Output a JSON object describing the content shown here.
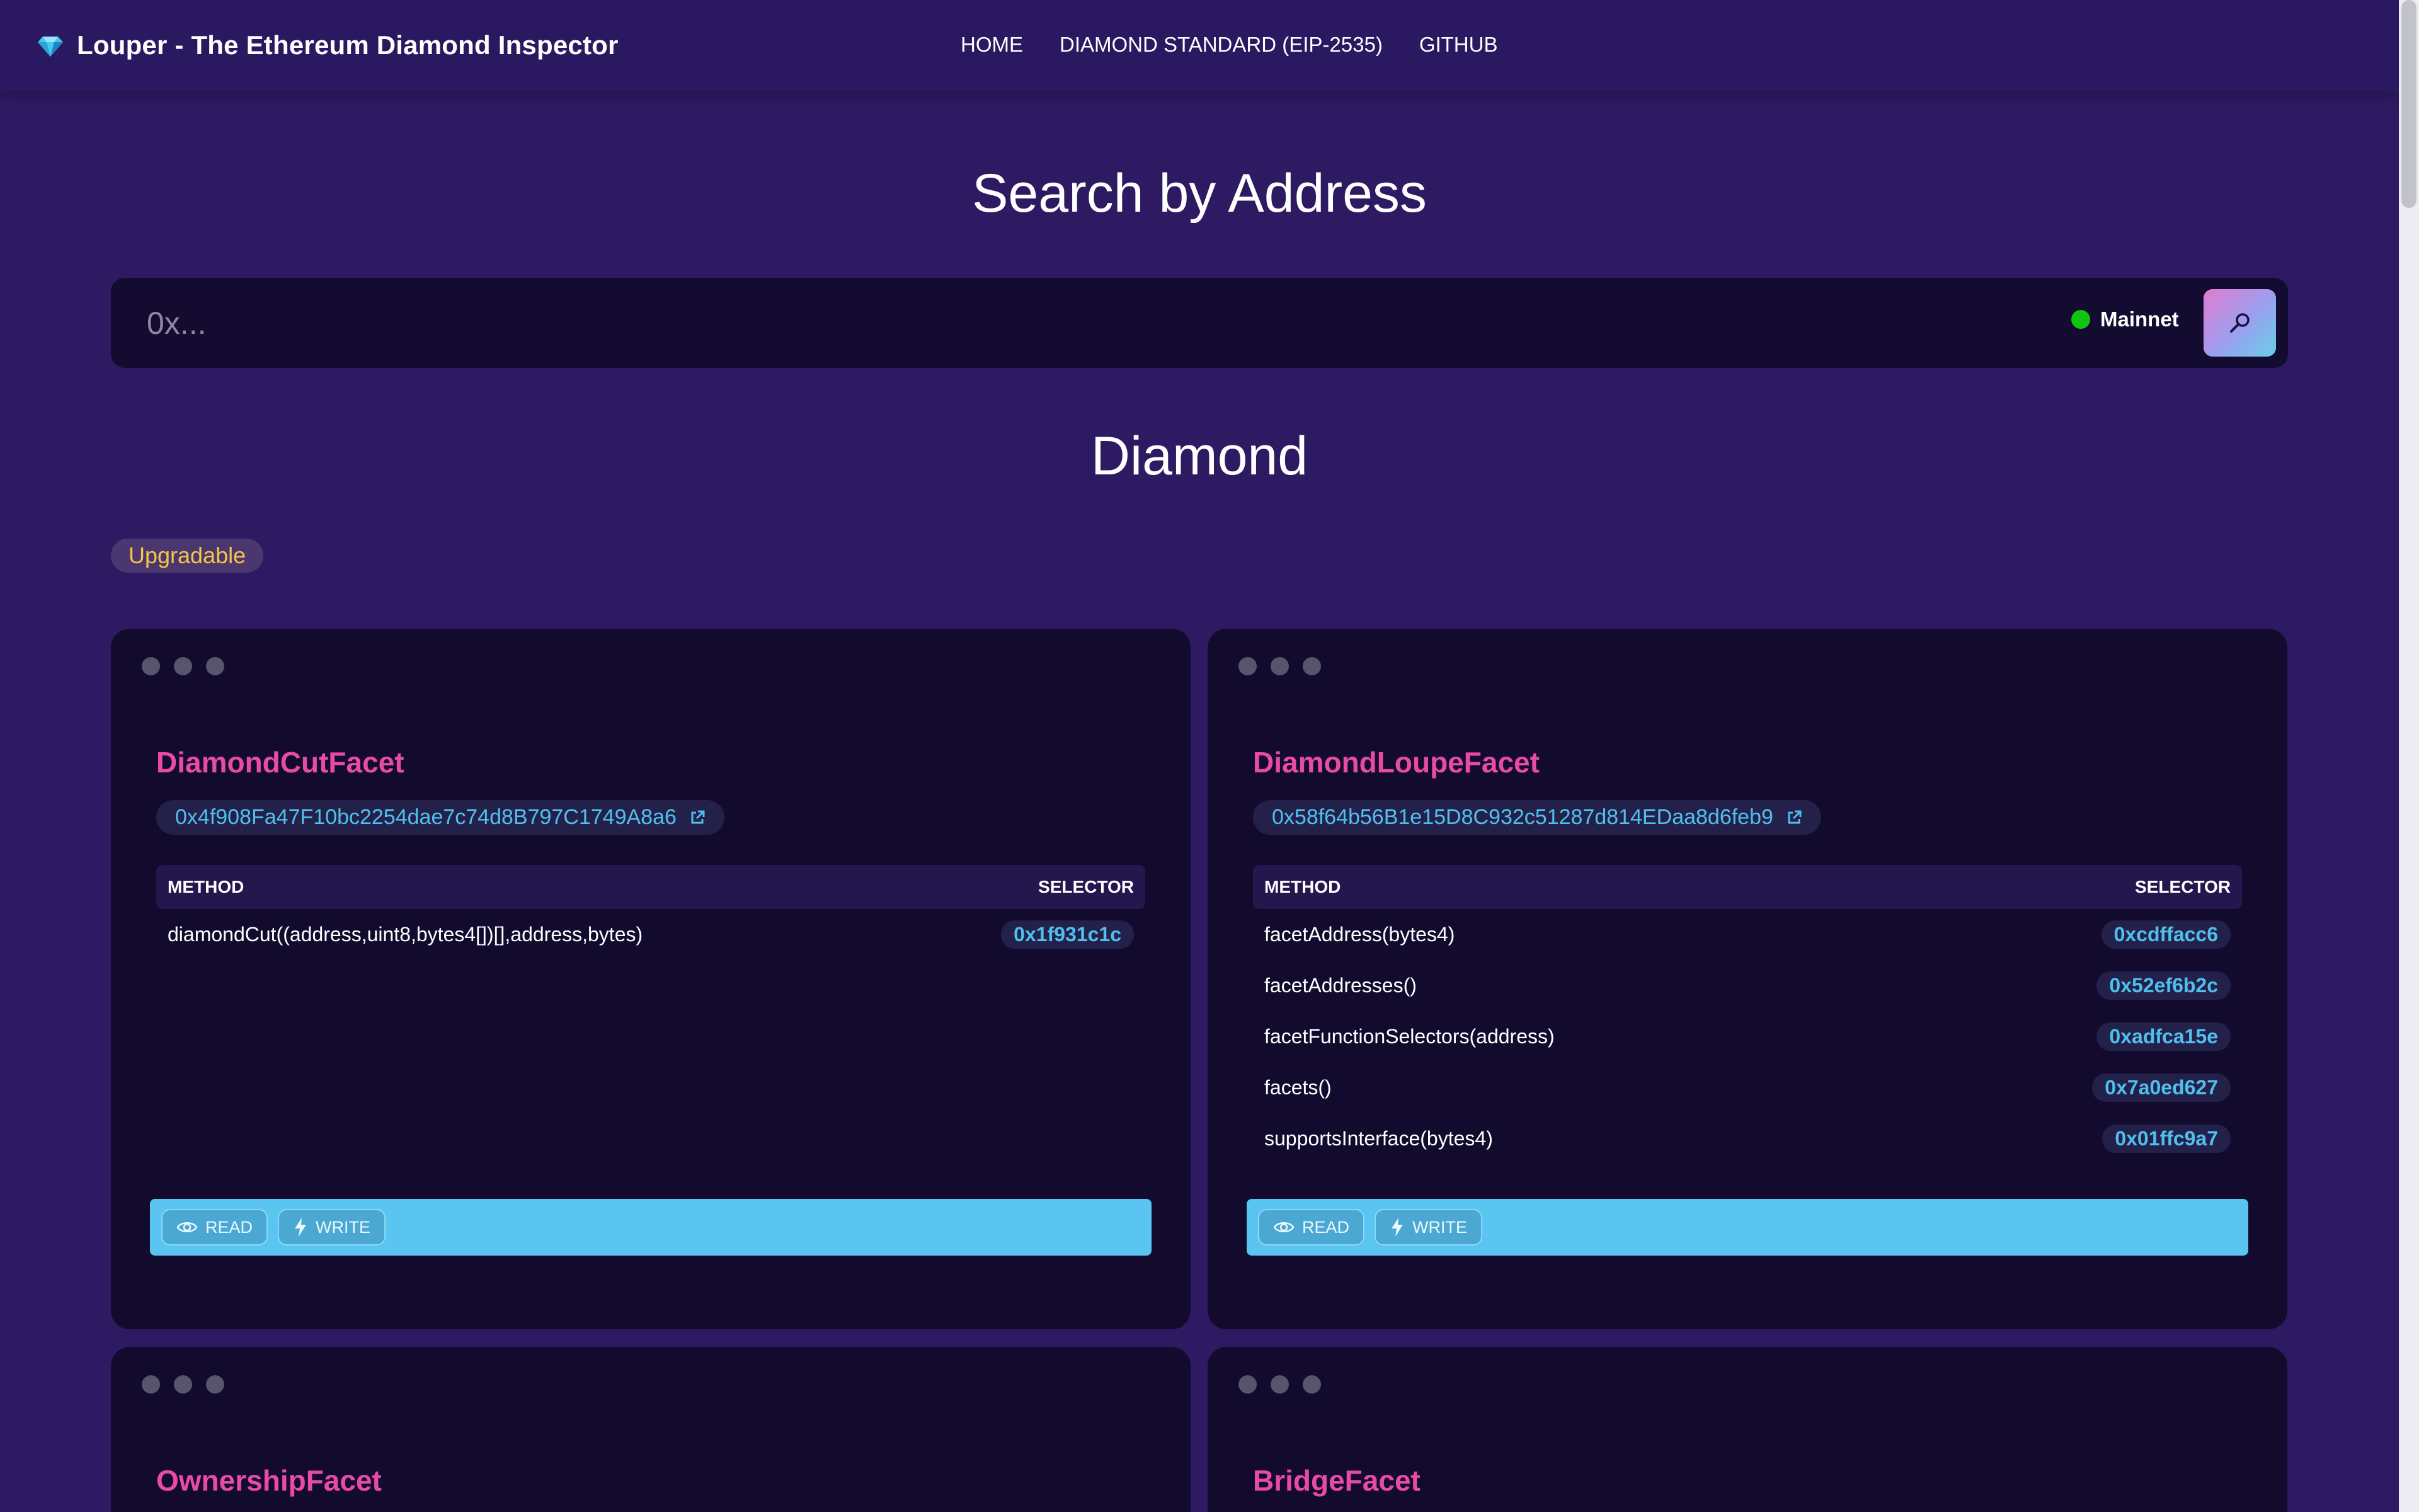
{
  "header": {
    "title": "Louper - The Ethereum Diamond Inspector",
    "nav": [
      "HOME",
      "DIAMOND STANDARD (EIP-2535)",
      "GITHUB"
    ]
  },
  "search": {
    "heading": "Search by Address",
    "placeholder": "0x...",
    "network": "Mainnet"
  },
  "diamond": {
    "title": "Diamond",
    "badge": "Upgradable"
  },
  "table_headers": {
    "method": "METHOD",
    "selector": "SELECTOR"
  },
  "actions": {
    "read": "READ",
    "write": "WRITE"
  },
  "facets": [
    {
      "name": "DiamondCutFacet",
      "address": "0x4f908Fa47F10bc2254dae7c74d8B797C1749A8a6",
      "methods": [
        {
          "signature": "diamondCut((address,uint8,bytes4[])[],address,bytes)",
          "selector": "0x1f931c1c"
        }
      ]
    },
    {
      "name": "DiamondLoupeFacet",
      "address": "0x58f64b56B1e15D8C932c51287d814EDaa8d6feb9",
      "methods": [
        {
          "signature": "facetAddress(bytes4)",
          "selector": "0xcdffacc6"
        },
        {
          "signature": "facetAddresses()",
          "selector": "0x52ef6b2c"
        },
        {
          "signature": "facetFunctionSelectors(address)",
          "selector": "0xadfca15e"
        },
        {
          "signature": "facets()",
          "selector": "0x7a0ed627"
        },
        {
          "signature": "supportsInterface(bytes4)",
          "selector": "0x01ffc9a7"
        }
      ]
    },
    {
      "name": "OwnershipFacet"
    },
    {
      "name": "BridgeFacet"
    }
  ],
  "colors": {
    "page_bg": "#2d1a63",
    "card_bg": "#130b2e",
    "facet_name": "#e84aa6",
    "address": "#4fc0ee",
    "action_bar": "#59c5f0",
    "badge_text": "#f5c547",
    "network_dot": "#12c412"
  }
}
